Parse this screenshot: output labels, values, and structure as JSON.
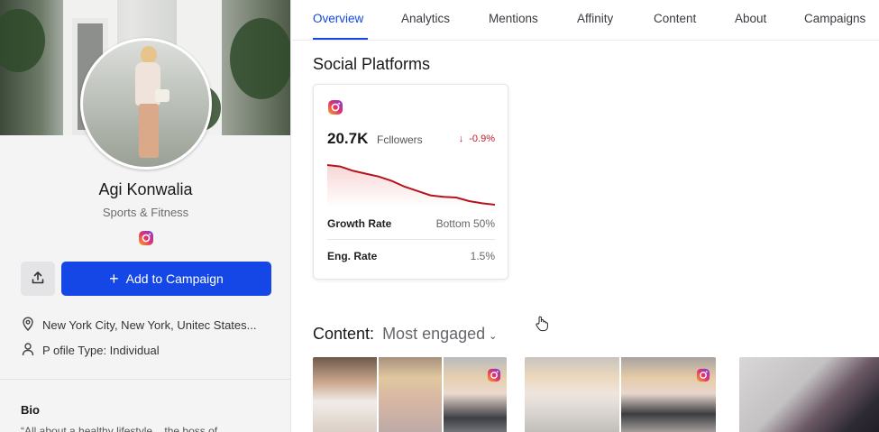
{
  "profile": {
    "name": "Agi Konwalia",
    "category": "Sports & Fitness",
    "location": "New York City, New York, Unitec States...",
    "profile_type": "P ofile Type: Individual",
    "add_button_label": "Add to Campaign",
    "bio_heading": "Bio",
    "bio_text": "“All about a healthy lifestyle... the boss of..."
  },
  "tabs": [
    {
      "label": "Overview",
      "active": true
    },
    {
      "label": "Analytics",
      "active": false
    },
    {
      "label": "Mentions",
      "active": false
    },
    {
      "label": "Affinity",
      "active": false
    },
    {
      "label": "Content",
      "active": false
    },
    {
      "label": "About",
      "active": false
    },
    {
      "label": "Campaigns",
      "active": false
    }
  ],
  "social": {
    "heading": "Social Platforms",
    "platform_icon": "instagram-icon",
    "followers_count": "20.7K",
    "followers_label": "Fcllowers",
    "followers_change": "-0.9%",
    "growth_label": "Growth Rate",
    "growth_value": "Bottom 50%",
    "eng_label": "Eng. Rate",
    "eng_value": "1.5%",
    "trend": [
      100,
      98,
      92,
      88,
      84,
      78,
      70,
      64,
      58,
      56,
      55,
      50,
      47,
      45
    ],
    "trend_color": "#b4141e"
  },
  "content": {
    "heading": "Content:",
    "sort_label": "Most engaged",
    "sort_icon": "chevron-down-icon"
  },
  "colors": {
    "accent": "#1447e6",
    "negative": "#c21c2c"
  }
}
